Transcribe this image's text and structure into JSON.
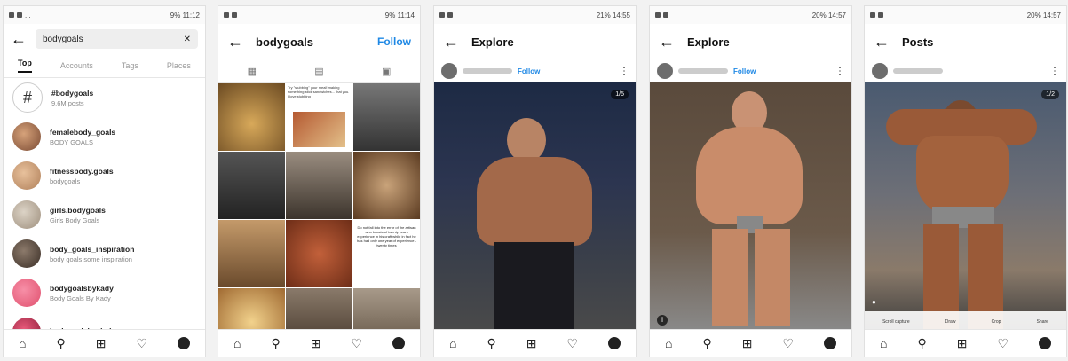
{
  "panels": [
    {
      "status": {
        "right": "    9% 11:12"
      },
      "search": {
        "value": "bodygoals",
        "clear_icon": "close-icon"
      },
      "tabs": [
        "Top",
        "Accounts",
        "Tags",
        "Places"
      ],
      "results": [
        {
          "name": "#bodygoals",
          "sub": "9.6M posts"
        },
        {
          "name": "femalebody_goals",
          "sub": "BODY GOALS"
        },
        {
          "name": "fitnessbody.goals",
          "sub": "bodygoals"
        },
        {
          "name": "girls.bodygoals",
          "sub": "Girls Body Goals"
        },
        {
          "name": "body_goals_inspiration",
          "sub": "body goals some inspiration"
        },
        {
          "name": "bodygoalsbykady",
          "sub": "Body Goals By Kady"
        },
        {
          "name": "bodygoalsbychelsea",
          "sub": ""
        }
      ]
    },
    {
      "status": {
        "right": "9% 11:14"
      },
      "title": "bodygoals",
      "follow": "Follow",
      "grid_text": [
        "Try \"stubbing\" your meal! making something stick sandwiches... that you. I love stubbing",
        "Do not fall into the error of the artisan who boasts of twenty years experience in his craft while in fact he has had only one year of experience - twenty times"
      ]
    },
    {
      "status": {
        "right": "21% 14:55"
      },
      "title": "Explore",
      "follow": "Follow",
      "counter": "1/5"
    },
    {
      "status": {
        "right": "20% 14:57"
      },
      "title": "Explore",
      "follow": "Follow"
    },
    {
      "status": {
        "right": "20% 14:57"
      },
      "title": "Posts",
      "counter": "1/2",
      "actions": [
        "Scroll capture",
        "Draw",
        "Crop",
        "Share"
      ]
    }
  ],
  "icons": {
    "back": "arrow-left-icon",
    "home": "home-icon",
    "search": "search-icon",
    "add": "add-icon",
    "heart": "heart-icon"
  }
}
